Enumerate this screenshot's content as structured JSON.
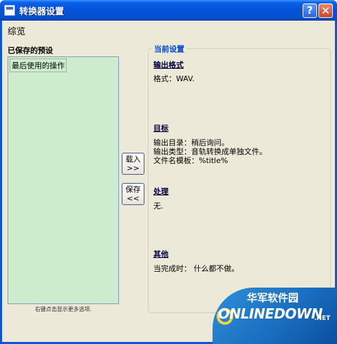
{
  "window": {
    "title": "转换器设置"
  },
  "overview_label": "综览",
  "saved_presets": {
    "label": "已保存的预设",
    "items": [
      "最后使用的操作"
    ],
    "hint": "右键点击显示更多选项."
  },
  "buttons": {
    "load_line1": "载入",
    "load_line2": ">>",
    "save_line1": "保存",
    "save_line2": "<<"
  },
  "current_settings": {
    "legend": "当前设置",
    "output_format": {
      "heading": "输出格式",
      "lines": [
        "格式：WAV."
      ]
    },
    "target": {
      "heading": "目标",
      "lines": [
        "输出目录：稍后询问。",
        "输出类型：音轨转换成单独文件。",
        "文件名模板：%title%"
      ]
    },
    "processing": {
      "heading": "处理",
      "lines": [
        "无."
      ]
    },
    "other": {
      "heading": "其他",
      "lines": [
        "当完成时： 什么都不做。"
      ]
    }
  },
  "watermark": {
    "cn": "华军软件园",
    "en": "ONLINEDOWN",
    "suffix": ".NET"
  }
}
